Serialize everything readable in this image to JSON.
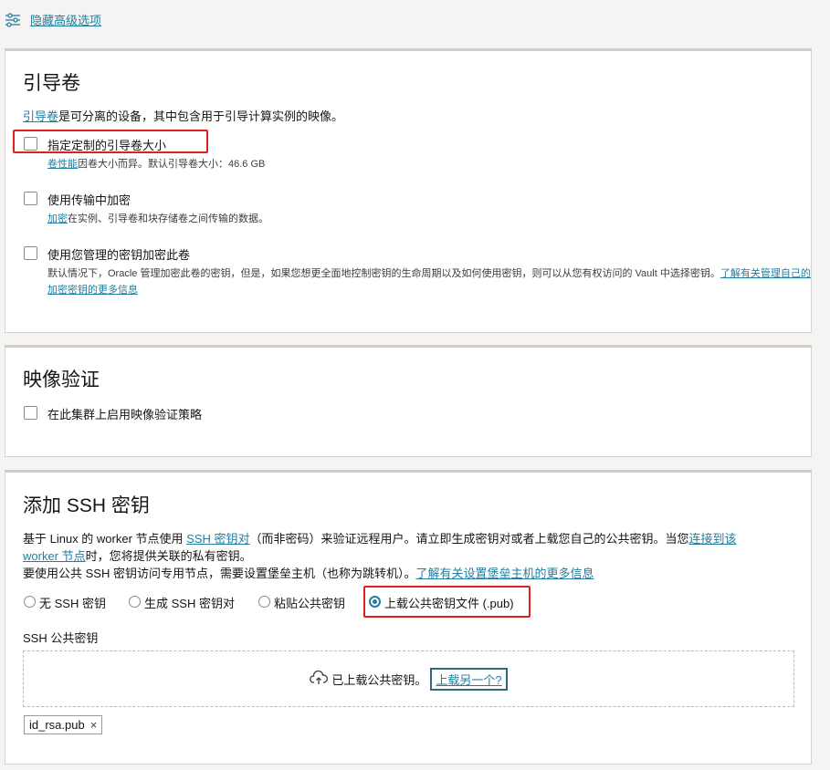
{
  "header": {
    "toggle_label": "隐藏高级选项",
    "toggle_icon": "sliders-icon"
  },
  "boot_volume": {
    "title": "引导卷",
    "desc_link": "引导卷",
    "desc_rest": "是可分离的设备，其中包含用于引导计算实例的映像。",
    "custom_size": {
      "label": "指定定制的引导卷大小",
      "checked": false,
      "help_link": "卷性能",
      "help_rest": "因卷大小而异。默认引导卷大小：46.6 GB"
    },
    "in_transit": {
      "label": "使用传输中加密",
      "checked": false,
      "help_link": "加密",
      "help_rest": "在实例、引导卷和块存储卷之间传输的数据。"
    },
    "own_key": {
      "label": "使用您管理的密钥加密此卷",
      "checked": false,
      "help_text": "默认情况下，Oracle 管理加密此卷的密钥，但是，如果您想更全面地控制密钥的生命周期以及如何使用密钥，则可以从您有权访问的 Vault 中选择密钥。",
      "help_link_1": "了解有关管理自己的",
      "help_link_2": "加密密钥的更多信息"
    }
  },
  "image_verification": {
    "title": "映像验证",
    "policy": {
      "label": "在此集群上启用映像验证策略",
      "checked": false
    }
  },
  "ssh": {
    "title": "添加 SSH 密钥",
    "line1_a": "基于 Linux 的 worker 节点使用 ",
    "line1_link": "SSH 密钥对",
    "line1_b": "（而非密码）来验证远程用户。请立即生成密钥对或者上载您自己的公共密钥。当您",
    "line1_link2": "连接到该",
    "line2_link": "worker 节点",
    "line2_rest": "时，您将提供关联的私有密钥。",
    "line3_text": "要使用公共 SSH 密钥访问专用节点，需要设置堡垒主机（也称为跳转机）。",
    "line3_link": "了解有关设置堡垒主机的更多信息",
    "options": [
      "无 SSH 密钥",
      "生成 SSH 密钥对",
      "粘贴公共密钥",
      "上载公共密钥文件 (.pub)"
    ],
    "selected": "上载公共密钥文件 (.pub)",
    "public_key_label": "SSH 公共密钥",
    "uploaded_text": "已上载公共密钥。",
    "upload_another": "上载另一个?",
    "file_chip": "id_rsa.pub"
  },
  "colors": {
    "accent": "#227e9e",
    "highlight": "#e02020"
  }
}
